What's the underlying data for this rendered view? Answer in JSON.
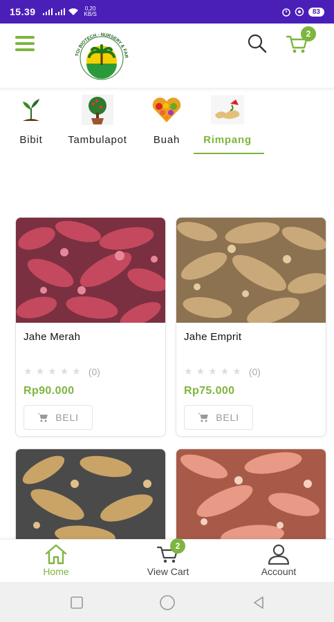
{
  "status_bar": {
    "time": "15.39",
    "network_speed_value": "0,20",
    "network_speed_unit": "KB/S",
    "battery": "83"
  },
  "header": {
    "menu_icon": "hamburger-menu-icon",
    "logo_text": "TOI BIOTECH - NURSERY & FARM",
    "search_icon": "search-icon",
    "cart_icon": "shopping-cart-icon",
    "cart_count": "2"
  },
  "categories": [
    {
      "label": "Bibit",
      "icon": "seedling-icon",
      "active": false
    },
    {
      "label": "Tambulapot",
      "icon": "potted-tree-icon",
      "active": false
    },
    {
      "label": "Buah",
      "icon": "fruit-heart-icon",
      "active": false
    },
    {
      "label": "Rimpang",
      "icon": "ginger-icon",
      "active": true
    }
  ],
  "products": [
    {
      "name": "Jahe Merah",
      "rating_count": "(0)",
      "price": "Rp90.000",
      "buy_label": "BELI"
    },
    {
      "name": "Jahe Emprit",
      "rating_count": "(0)",
      "price": "Rp75.000",
      "buy_label": "BELI"
    },
    {
      "name": "",
      "rating_count": "",
      "price": "",
      "buy_label": ""
    },
    {
      "name": "",
      "rating_count": "",
      "price": "",
      "buy_label": ""
    }
  ],
  "bottom_nav": {
    "home": "Home",
    "view_cart": "View Cart",
    "cart_count": "2",
    "account": "Account"
  },
  "colors": {
    "accent": "#7db53e",
    "status_bar": "#4a1fb8"
  }
}
